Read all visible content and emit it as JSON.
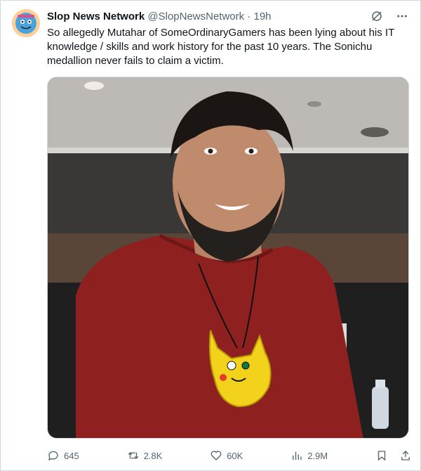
{
  "account": {
    "display_name": "Slop News Network",
    "handle": "@SlopNewsNetwork",
    "separator": "·",
    "timestamp": "19h"
  },
  "tweet": {
    "text": "So allegedly Mutahar of SomeOrdinaryGamers has been lying about his IT knowledge / skills and work history for the past 10 years. The Sonichu medallion never fails to claim a victim."
  },
  "stats": {
    "replies": "645",
    "retweets": "2.8K",
    "likes": "60K",
    "views": "2.9M"
  },
  "colors": {
    "text": "#0f1419",
    "muted": "#536471",
    "border": "#cfd9de",
    "shirt": "#8e2020",
    "medallion": "#f2d21b"
  },
  "icons": [
    "grok-icon",
    "more-icon",
    "reply-icon",
    "retweet-icon",
    "like-icon",
    "views-icon",
    "bookmark-icon",
    "share-icon"
  ]
}
